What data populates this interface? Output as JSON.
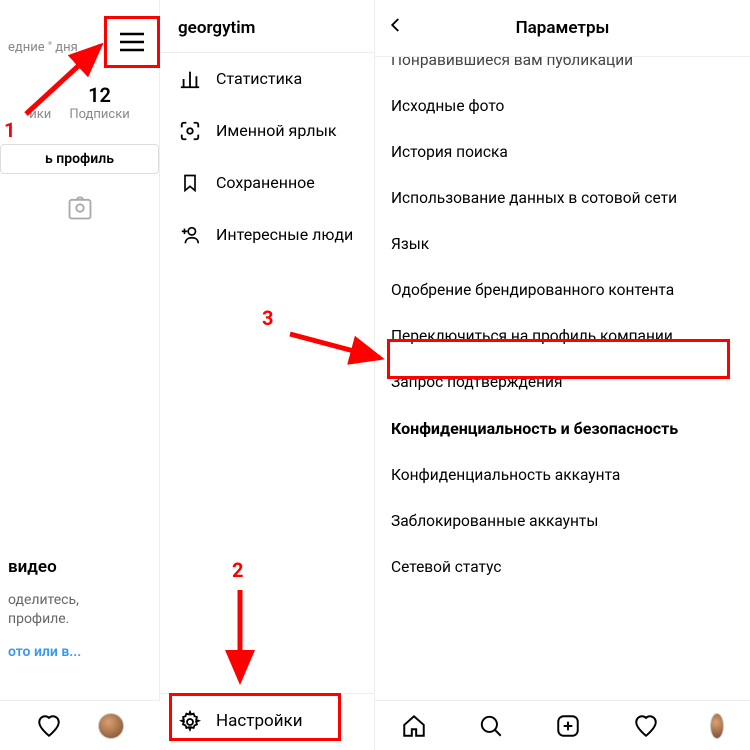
{
  "left": {
    "header_fragment": "едние \" дня",
    "stat_number": "12",
    "stat_label": "Подписки",
    "stat_label_left": "ики",
    "edit_profile_fragment": "ь профиль",
    "video_section_title": "видео",
    "video_desc_line1": "оделитесь,",
    "video_desc_line2": "профиле.",
    "video_link": "ото или в..."
  },
  "drawer": {
    "username": "georgytim",
    "items": [
      {
        "label": "Статистика"
      },
      {
        "label": "Именной ярлык"
      },
      {
        "label": "Сохраненное"
      },
      {
        "label": "Интересные люди"
      }
    ],
    "footer_label": "Настройки"
  },
  "settings": {
    "title": "Параметры",
    "items": [
      {
        "label": "Понравившиеся вам публикации",
        "cut": true
      },
      {
        "label": "Исходные фото"
      },
      {
        "label": "История поиска"
      },
      {
        "label": "Использование данных в сотовой сети"
      },
      {
        "label": "Язык"
      },
      {
        "label": "Одобрение брендированного контента"
      },
      {
        "label": "Переключиться на профиль компании"
      },
      {
        "label": "Запрос подтверждения"
      }
    ],
    "section_header": "Конфиденциальность и безопасность",
    "items2": [
      {
        "label": "Конфиденциальность аккаунта"
      },
      {
        "label": "Заблокированные аккаунты"
      },
      {
        "label": "Сетевой статус"
      }
    ]
  },
  "annotations": {
    "num1": "1",
    "num2": "2",
    "num3": "3"
  }
}
